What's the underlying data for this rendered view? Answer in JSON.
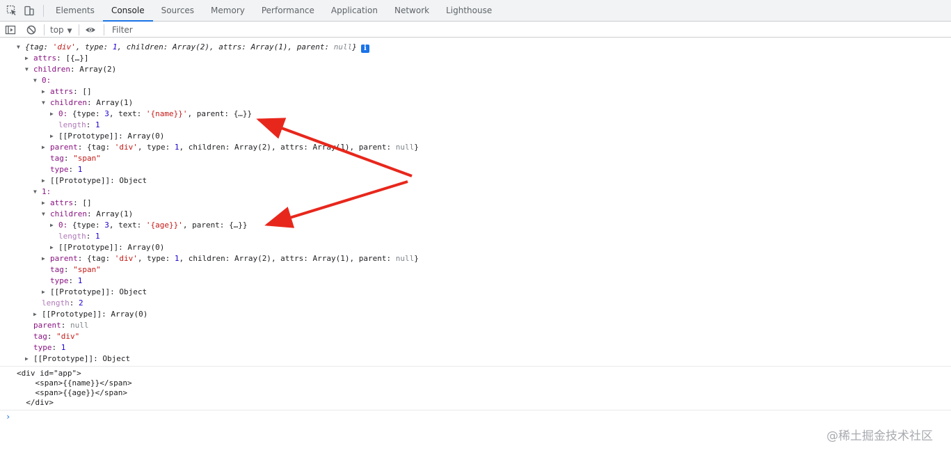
{
  "tabs": [
    "Elements",
    "Console",
    "Sources",
    "Memory",
    "Performance",
    "Application",
    "Network",
    "Lighthouse"
  ],
  "active_tab": "Console",
  "toolbar": {
    "context": "top",
    "filter_placeholder": "Filter"
  },
  "tree": {
    "root_summary": {
      "tag_val": "'div'",
      "type_val": "1",
      "children_val": "Array(2)",
      "attrs_val": "Array(1)",
      "parent_val": "null"
    },
    "root_attrs": "[{…}]",
    "root_children": "Array(2)",
    "item0": {
      "index": "0:",
      "attrs": "[]",
      "children": "Array(1)",
      "child_key": "0:",
      "child_type": "3",
      "child_text": "'{name}}'",
      "child_parent": "{…}}",
      "length": "1",
      "proto_array": "Array(0)",
      "parent_tag": "'div'",
      "parent_type": "1",
      "parent_children": "Array(2)",
      "parent_attrs": "Array(1)",
      "parent_parent": "null",
      "tag": "\"span\"",
      "type": "1",
      "proto_object": "Object"
    },
    "item1": {
      "index": "1:",
      "attrs": "[]",
      "children": "Array(1)",
      "child_key": "0:",
      "child_type": "3",
      "child_text": "'{age}}'",
      "child_parent": "{…}}",
      "length": "1",
      "proto_array": "Array(0)",
      "parent_tag": "'div'",
      "parent_type": "1",
      "parent_children": "Array(2)",
      "parent_attrs": "Array(1)",
      "parent_parent": "null",
      "tag": "\"span\"",
      "type": "1",
      "proto_object": "Object"
    },
    "children_length": "2",
    "children_proto": "Array(0)",
    "root_parent": "null",
    "root_tag": "\"div\"",
    "root_type": "1",
    "root_proto": "Object"
  },
  "html_output": [
    "<div id=\"app\">",
    "    <span>{{name}}</span>",
    "    <span>{{age}}</span>",
    "  </div>"
  ],
  "prompt_symbol": "›",
  "watermark": "@稀土掘金技术社区",
  "colors": {
    "accent": "#1a73e8",
    "property_key": "#881280",
    "string": "#c41a16",
    "number": "#1c00cf",
    "annotation_arrow": "#e8271c"
  }
}
